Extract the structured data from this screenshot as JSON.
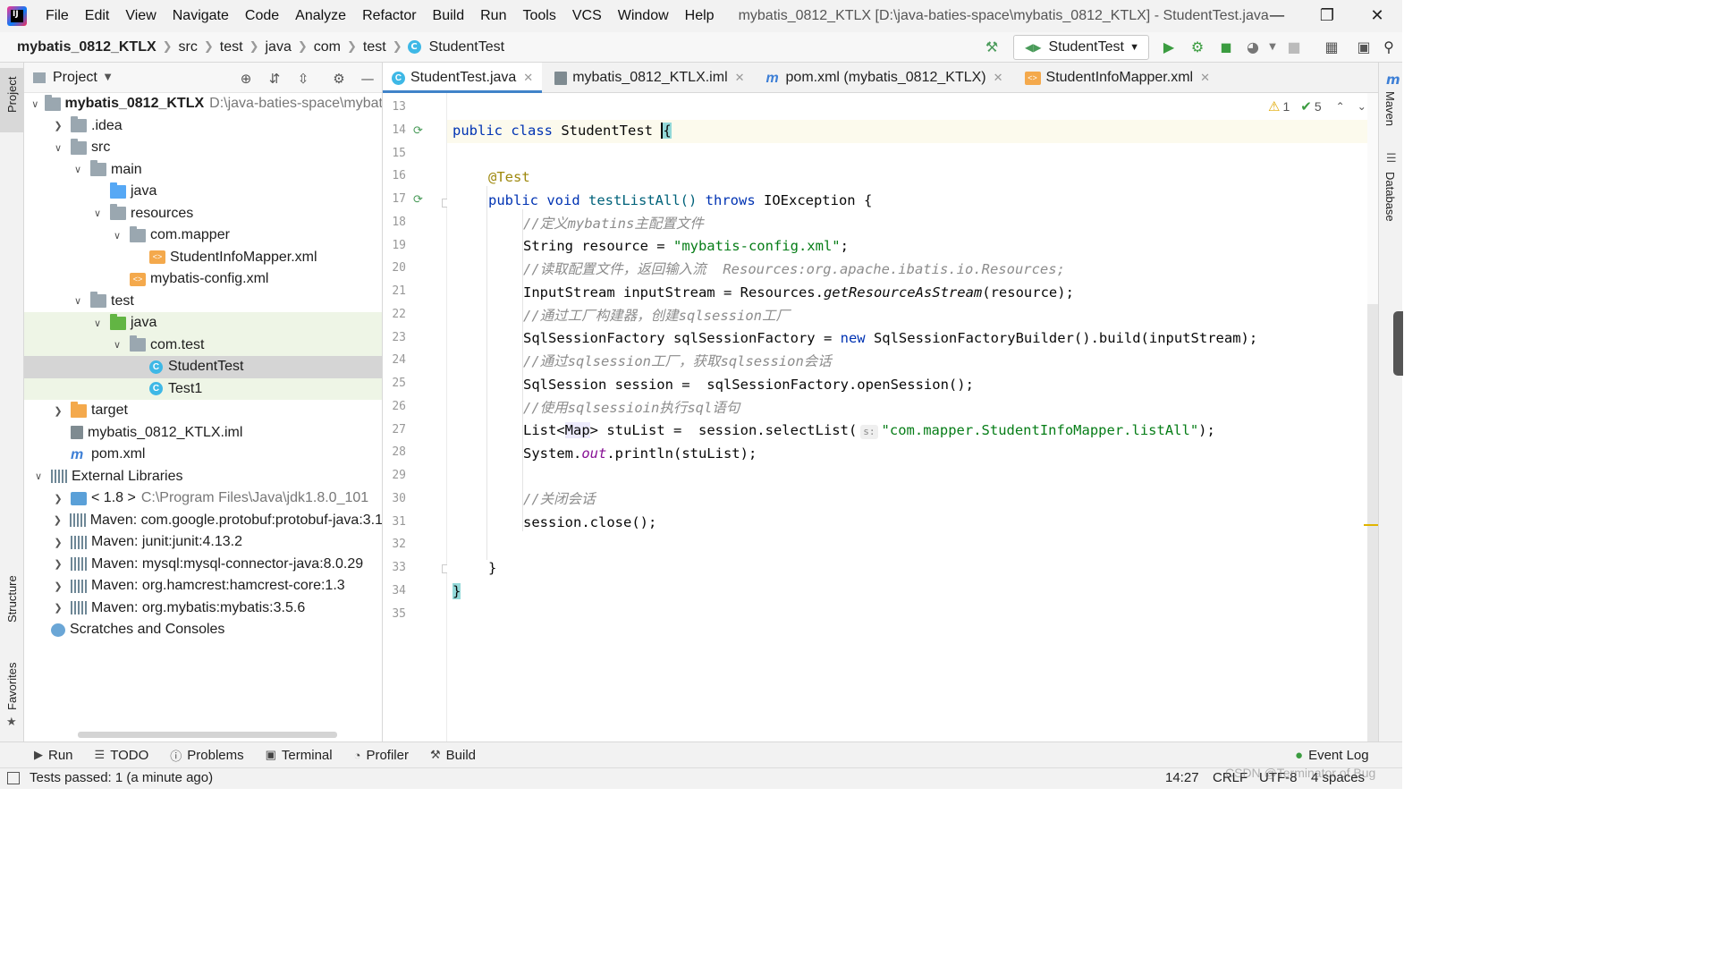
{
  "menu": [
    "File",
    "Edit",
    "View",
    "Navigate",
    "Code",
    "Analyze",
    "Refactor",
    "Build",
    "Run",
    "Tools",
    "VCS",
    "Window",
    "Help"
  ],
  "window_title": "mybatis_0812_KTLX [D:\\java-baties-space\\mybatis_0812_KTLX] - StudentTest.java",
  "breadcrumb": [
    "mybatis_0812_KTLX",
    "src",
    "test",
    "java",
    "com",
    "test",
    "StudentTest"
  ],
  "run_config": "StudentTest",
  "left_stripe": {
    "project": "Project",
    "structure": "Structure",
    "favorites": "Favorites"
  },
  "right_stripe": {
    "maven": "Maven",
    "database": "Database"
  },
  "project_panel": {
    "title": "Project",
    "tree": [
      {
        "arrow": "v",
        "icon": "module",
        "label": "mybatis_0812_KTLX",
        "extra": "D:\\java-baties-space\\mybat",
        "level": 0,
        "bold": true
      },
      {
        "arrow": ">",
        "icon": "folder",
        "label": ".idea",
        "level": 1
      },
      {
        "arrow": "v",
        "icon": "folder",
        "label": "src",
        "level": 1
      },
      {
        "arrow": "v",
        "icon": "folder",
        "label": "main",
        "level": 2
      },
      {
        "arrow": "",
        "icon": "folder-blue",
        "label": "java",
        "level": 3
      },
      {
        "arrow": "v",
        "icon": "folder",
        "label": "resources",
        "level": 3
      },
      {
        "arrow": "v",
        "icon": "folder",
        "label": "com.mapper",
        "level": 4
      },
      {
        "arrow": "",
        "icon": "xml",
        "label": "StudentInfoMapper.xml",
        "level": 5
      },
      {
        "arrow": "",
        "icon": "xml",
        "label": "mybatis-config.xml",
        "level": 4
      },
      {
        "arrow": "v",
        "icon": "folder",
        "label": "test",
        "level": 2
      },
      {
        "arrow": "v",
        "icon": "folder-green",
        "label": "java",
        "level": 3,
        "hl": true
      },
      {
        "arrow": "v",
        "icon": "folder",
        "label": "com.test",
        "level": 4,
        "hl": true
      },
      {
        "arrow": "",
        "icon": "class",
        "label": "StudentTest",
        "level": 5,
        "sel": true
      },
      {
        "arrow": "",
        "icon": "class",
        "label": "Test1",
        "level": 5,
        "hl": true
      },
      {
        "arrow": ">",
        "icon": "folder-orange",
        "label": "target",
        "level": 1
      },
      {
        "arrow": "",
        "icon": "iml",
        "label": "mybatis_0812_KTLX.iml",
        "level": 1
      },
      {
        "arrow": "",
        "icon": "pom",
        "label": "pom.xml",
        "level": 1
      },
      {
        "arrow": "v",
        "icon": "lib",
        "label": "External Libraries",
        "level": 0
      },
      {
        "arrow": ">",
        "icon": "jdk",
        "label": "< 1.8 >",
        "extra": "C:\\Program Files\\Java\\jdk1.8.0_101",
        "level": 1
      },
      {
        "arrow": ">",
        "icon": "lib",
        "label": "Maven: com.google.protobuf:protobuf-java:3.1",
        "level": 1
      },
      {
        "arrow": ">",
        "icon": "lib",
        "label": "Maven: junit:junit:4.13.2",
        "level": 1
      },
      {
        "arrow": ">",
        "icon": "lib",
        "label": "Maven: mysql:mysql-connector-java:8.0.29",
        "level": 1
      },
      {
        "arrow": ">",
        "icon": "lib",
        "label": "Maven: org.hamcrest:hamcrest-core:1.3",
        "level": 1
      },
      {
        "arrow": ">",
        "icon": "lib",
        "label": "Maven: org.mybatis:mybatis:3.5.6",
        "level": 1
      },
      {
        "arrow": "",
        "icon": "scratch",
        "label": "Scratches and Consoles",
        "level": 0
      }
    ]
  },
  "editor_tabs": [
    {
      "label": "StudentTest.java",
      "icon": "class-icon",
      "active": true
    },
    {
      "label": "mybatis_0812_KTLX.iml",
      "icon": "iml-icon",
      "active": false
    },
    {
      "label": "pom.xml (mybatis_0812_KTLX)",
      "icon": "maven-icon",
      "active": false
    },
    {
      "label": "StudentInfoMapper.xml",
      "icon": "xml-icon",
      "active": false
    }
  ],
  "inspection": {
    "warnings": "1",
    "ok": "5"
  },
  "line_numbers": [
    "13",
    "14",
    "15",
    "16",
    "17",
    "18",
    "19",
    "20",
    "21",
    "22",
    "23",
    "24",
    "25",
    "26",
    "27",
    "28",
    "29",
    "30",
    "31",
    "32",
    "33",
    "34",
    "35"
  ],
  "code": {
    "l14_kw1": "public",
    "l14_kw2": "class",
    "l14_name": " StudentTest ",
    "l14_brace": "{",
    "l16_ann": "@Test",
    "l17_kw1": "public",
    "l17_kw2": "void",
    "l17_name": " testListAll() ",
    "l17_kw3": "throws",
    "l17_rest": " IOException {",
    "l18_cmt": "//定义mybatins主配置文件",
    "l19_a": "String resource = ",
    "l19_str": "\"mybatis-config.xml\"",
    "l19_b": ";",
    "l20_cmt": "//读取配置文件，返回输入流  Resources:org.apache.ibatis.io.Resources;",
    "l21_a": "InputStream inputStream = Resources.",
    "l21_m": "getResourceAsStream",
    "l21_b": "(resource);",
    "l22_cmt": "//通过工厂构建器，创建sqlsession工厂",
    "l23_a": "SqlSessionFactory sqlSessionFactory = ",
    "l23_kw": "new",
    "l23_b": " SqlSessionFactoryBuilder().build(inputStream);",
    "l24_cmt": "//通过sqlsession工厂，获取sqlsession会话",
    "l25": "SqlSession session =  sqlSessionFactory.openSession();",
    "l26_cmt": "//使用sqlsessioin执行sql语句",
    "l27_a": "List<",
    "l27_type": "Map",
    "l27_b": "> stuList =  session.selectList(",
    "l27_hint": "s:",
    "l27_str": "\"com.mapper.StudentInfoMapper.listAll\"",
    "l27_c": ");",
    "l28_a": "System.",
    "l28_fld": "out",
    "l28_b": ".println(stuList);",
    "l30_cmt": "//关闭会话",
    "l31": "session.close();",
    "l33": "}",
    "l34": "}"
  },
  "bottom_tools": [
    {
      "label": "Run",
      "icon": "play-icon"
    },
    {
      "label": "TODO",
      "icon": "list-icon"
    },
    {
      "label": "Problems",
      "icon": "info-icon"
    },
    {
      "label": "Terminal",
      "icon": "terminal-icon"
    },
    {
      "label": "Profiler",
      "icon": "profiler-icon"
    },
    {
      "label": "Build",
      "icon": "hammer-icon"
    }
  ],
  "event_log": "Event Log",
  "status": {
    "message": "Tests passed: 1 (a minute ago)",
    "position": "14:27",
    "line_sep": "CRLF",
    "encoding": "UTF-8",
    "indent": "4 spaces"
  },
  "watermark": "CSDN @Terminator of Bug",
  "colors": {
    "accent": "#4083c9",
    "keyword": "#0033b3",
    "string": "#067d17",
    "comment": "#8c8c8c",
    "annotation": "#9e880d"
  }
}
